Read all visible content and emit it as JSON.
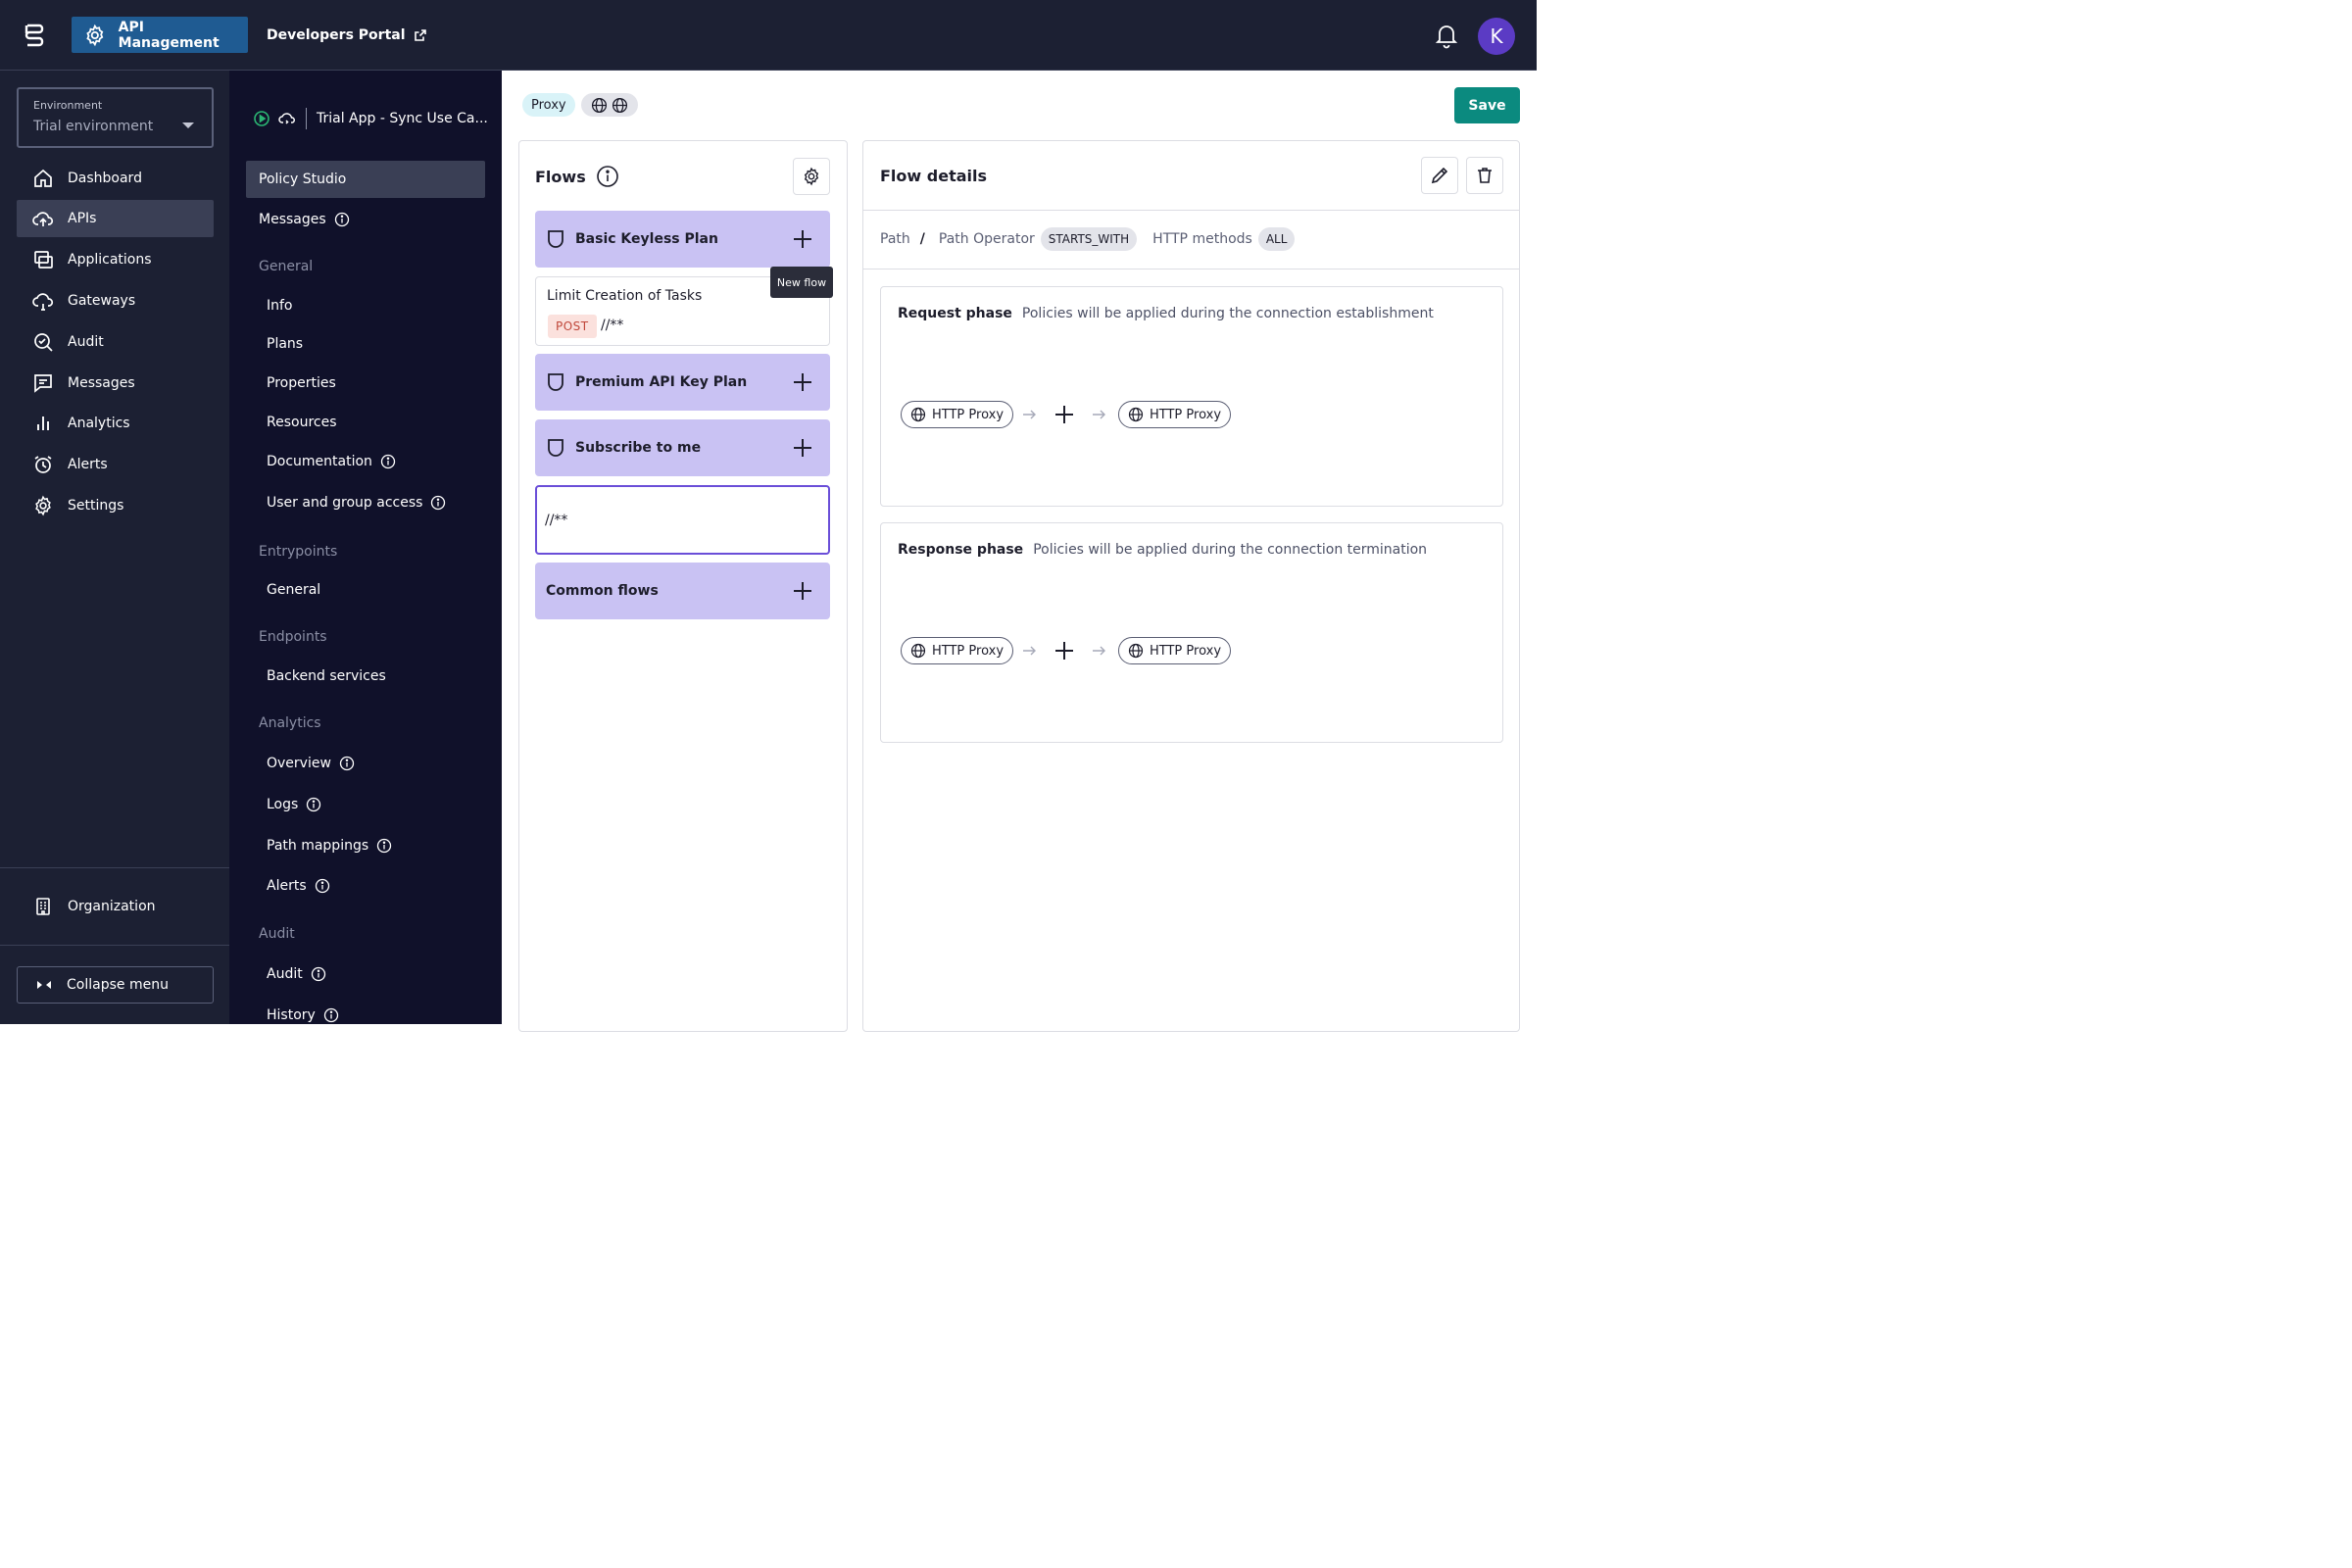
{
  "topbar": {
    "app_label": "API Management",
    "portal_label": "Developers Portal",
    "avatar_initial": "K"
  },
  "environment": {
    "label": "Environment",
    "value": "Trial environment"
  },
  "nav": {
    "items": [
      {
        "label": "Dashboard",
        "icon": "home-icon"
      },
      {
        "label": "APIs",
        "icon": "cloud-upload-icon",
        "active": true
      },
      {
        "label": "Applications",
        "icon": "applications-icon"
      },
      {
        "label": "Gateways",
        "icon": "cloud-gateway-icon"
      },
      {
        "label": "Audit",
        "icon": "audit-search-icon"
      },
      {
        "label": "Messages",
        "icon": "message-icon"
      },
      {
        "label": "Analytics",
        "icon": "bar-chart-icon"
      },
      {
        "label": "Alerts",
        "icon": "alarm-clock-icon"
      },
      {
        "label": "Settings",
        "icon": "gear-icon"
      }
    ],
    "organization": "Organization",
    "collapse": "Collapse menu"
  },
  "subnav": {
    "api_name": "Trial App - Sync Use Ca...",
    "policy_studio": "Policy Studio",
    "messages": "Messages",
    "general_section": "General",
    "general": [
      "Info",
      "Plans",
      "Properties",
      "Resources",
      "Documentation",
      "User and group access"
    ],
    "entrypoints_section": "Entrypoints",
    "entrypoints": [
      "General"
    ],
    "endpoints_section": "Endpoints",
    "endpoints": [
      "Backend services"
    ],
    "analytics_section": "Analytics",
    "analytics": [
      "Overview",
      "Logs",
      "Path mappings",
      "Alerts"
    ],
    "audit_section": "Audit",
    "audit": [
      "Audit",
      "History"
    ]
  },
  "toolbar": {
    "type_chip": "Proxy",
    "save": "Save"
  },
  "flows": {
    "title": "Flows",
    "plans": [
      "Basic Keyless Plan",
      "Premium API Key Plan",
      "Subscribe to me"
    ],
    "flow_item": {
      "name": "Limit Creation of Tasks",
      "method": "POST",
      "path": "//**"
    },
    "tooltip": "New flow",
    "selected_path": "//**",
    "common": "Common flows"
  },
  "details": {
    "title": "Flow details",
    "path_label": "Path",
    "path_value": "/",
    "operator_label": "Path Operator",
    "operator_value": "STARTS_WITH",
    "methods_label": "HTTP methods",
    "methods_value": "ALL",
    "request": {
      "title": "Request phase",
      "desc": "Policies will be applied during the connection establishment",
      "from": "HTTP Proxy",
      "to": "HTTP Proxy"
    },
    "response": {
      "title": "Response phase",
      "desc": "Policies will be applied during the connection termination",
      "from": "HTTP Proxy",
      "to": "HTTP Proxy"
    }
  },
  "colors": {
    "topbar": "#1c2033",
    "subnav": "#10112a",
    "accent": "#1f5b92",
    "plan_bg": "#c9c2f3",
    "save": "#0b8a7f"
  }
}
